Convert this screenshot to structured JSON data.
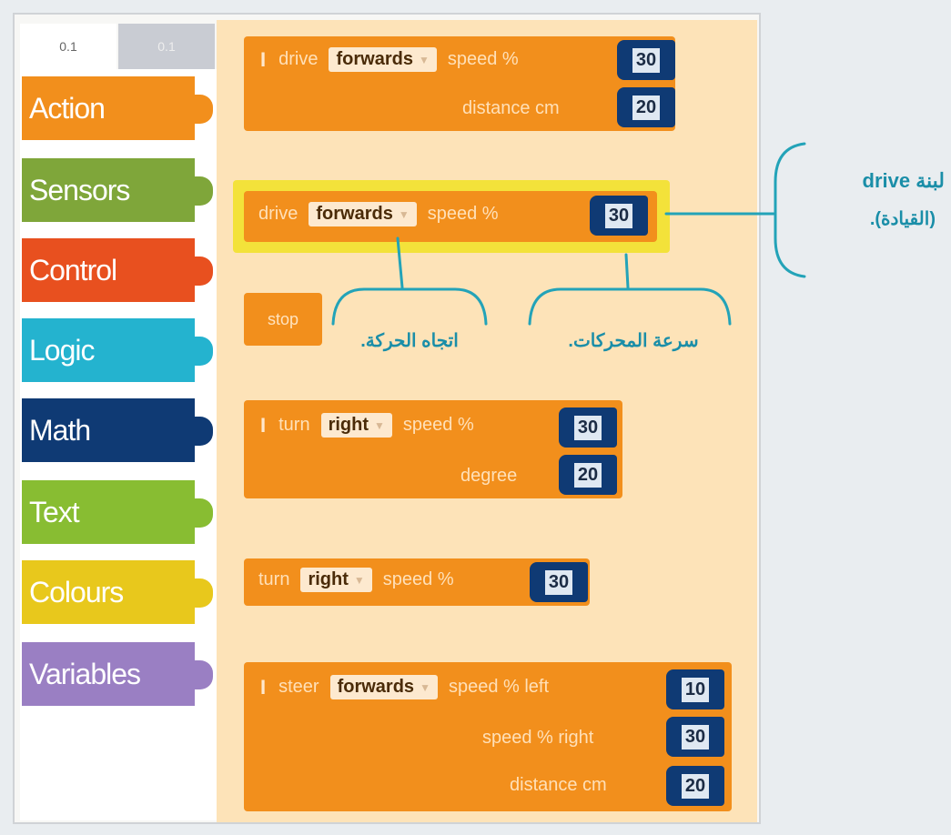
{
  "tabs": [
    "0.1",
    "0.1"
  ],
  "categories": [
    {
      "label": "Action",
      "color": "#f28f1c"
    },
    {
      "label": "Sensors",
      "color": "#7fa63a"
    },
    {
      "label": "Control",
      "color": "#e8501f"
    },
    {
      "label": "Logic",
      "color": "#24b3cf"
    },
    {
      "label": "Math",
      "color": "#0f3a74"
    },
    {
      "label": "Text",
      "color": "#88bd32"
    },
    {
      "label": "Colours",
      "color": "#e8c81c"
    },
    {
      "label": "Variables",
      "color": "#9a7fc3"
    }
  ],
  "blocks": {
    "drive_full": {
      "cmd": "drive",
      "direction": "forwards",
      "speed_label": "speed %",
      "speed": "30",
      "distance_label": "distance cm",
      "distance": "20"
    },
    "drive_simple": {
      "cmd": "drive",
      "direction": "forwards",
      "speed_label": "speed %",
      "speed": "30"
    },
    "stop": {
      "cmd": "stop"
    },
    "turn_full": {
      "cmd": "turn",
      "direction": "right",
      "speed_label": "speed %",
      "speed": "30",
      "degree_label": "degree",
      "degree": "20"
    },
    "turn_simple": {
      "cmd": "turn",
      "direction": "right",
      "speed_label": "speed %",
      "speed": "30"
    },
    "steer": {
      "cmd": "steer",
      "direction": "forwards",
      "left_label": "speed % left",
      "left": "10",
      "right_label": "speed % right",
      "right": "30",
      "distance_label": "distance cm",
      "distance": "20"
    }
  },
  "annotations": {
    "drive_block_line1": "لبنة drive",
    "drive_block_line2": "(القيادة).",
    "direction": "اتجاه الحركة.",
    "speed": "سرعة المحركات."
  }
}
